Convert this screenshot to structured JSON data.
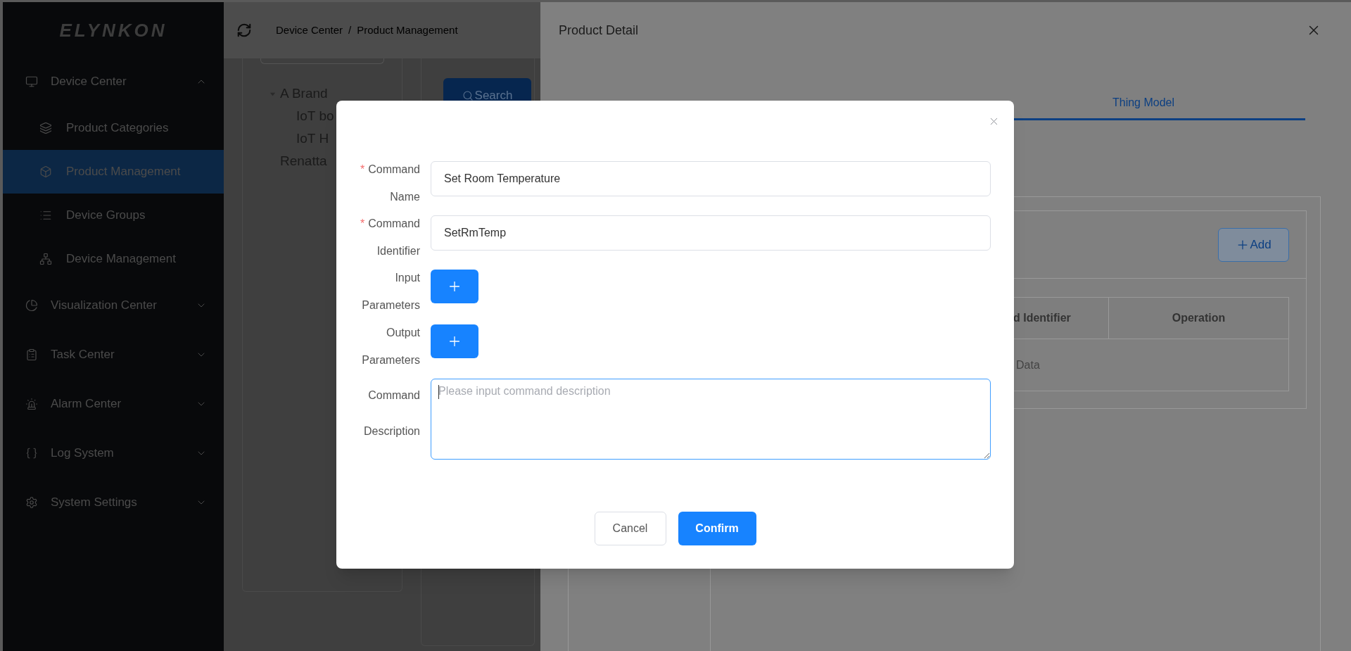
{
  "sidebar": {
    "logo": "ELYNKON",
    "items": [
      {
        "label": "Device Center",
        "expanded": true,
        "children": [
          {
            "label": "Product Categories",
            "selected": false
          },
          {
            "label": "Product Management",
            "selected": true
          },
          {
            "label": "Device Groups",
            "selected": false
          },
          {
            "label": "Device Management",
            "selected": false
          }
        ]
      },
      {
        "label": "Visualization Center",
        "expanded": false
      },
      {
        "label": "Task Center",
        "expanded": false
      },
      {
        "label": "Alarm Center",
        "expanded": false
      },
      {
        "label": "Log System",
        "expanded": false
      },
      {
        "label": "System Settings",
        "expanded": false
      }
    ]
  },
  "header": {
    "breadcrumb": [
      "Device Center",
      "Product Management"
    ],
    "breadcrumb_separator": "/"
  },
  "tree": {
    "nodes": [
      {
        "label": "A Brand",
        "expanded": true,
        "children": [
          {
            "label": "IoT bo"
          },
          {
            "label": "IoT H"
          }
        ]
      },
      {
        "label": "Renatta"
      }
    ]
  },
  "search_button": "Search",
  "drawer": {
    "title": "Product Detail",
    "tabs": [
      {
        "label": "Thing Model",
        "selected": true
      }
    ],
    "add_button": "Add",
    "table": {
      "columns": [
        "d Identifier",
        "Operation"
      ],
      "empty_text": "Data"
    }
  },
  "modal": {
    "required_mark": "*",
    "fields": [
      {
        "kind": "input",
        "required": true,
        "label_lines": [
          "Command",
          "Name"
        ],
        "value": "Set Room Temperature"
      },
      {
        "kind": "input",
        "required": true,
        "label_lines": [
          "Command",
          "Identifier"
        ],
        "value": "SetRmTemp"
      },
      {
        "kind": "add",
        "required": false,
        "label_lines": [
          "Input",
          "Parameters"
        ]
      },
      {
        "kind": "add",
        "required": false,
        "label_lines": [
          "Output",
          "Parameters"
        ]
      },
      {
        "kind": "textarea",
        "required": false,
        "label_lines": [
          "Command",
          "Description"
        ],
        "placeholder": "Please input command description",
        "focused": true
      }
    ],
    "buttons": [
      {
        "label": "Cancel",
        "kind": "default"
      },
      {
        "label": "Confirm",
        "kind": "primary"
      }
    ]
  }
}
